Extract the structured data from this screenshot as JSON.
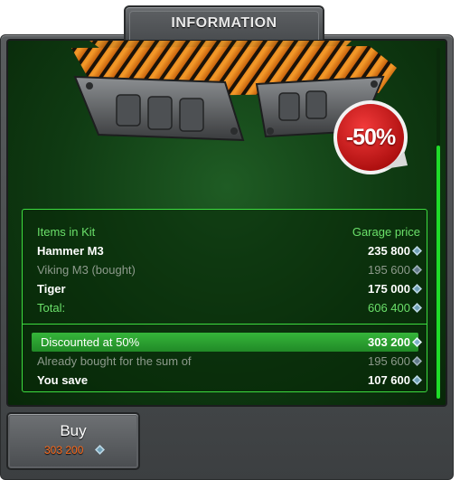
{
  "header": {
    "title": "INFORMATION"
  },
  "sticker": {
    "text": "-50%",
    "color": "#d31616"
  },
  "kit": {
    "columns": {
      "items": "Items in Kit",
      "price": "Garage price"
    },
    "items": [
      {
        "name": "Hammer M3",
        "price": "235 800",
        "state": "active"
      },
      {
        "name": "Viking M3 (bought)",
        "price": "195 600",
        "state": "owned"
      },
      {
        "name": "Tiger",
        "price": "175 000",
        "state": "active"
      }
    ],
    "total": {
      "label": "Total:",
      "price": "606 400"
    },
    "discount": {
      "label": "Discounted at 50%",
      "price": "303 200"
    },
    "already_bought": {
      "label": "Already bought for the sum of",
      "price": "195 600"
    },
    "savings": {
      "label": "You save",
      "price": "107 600"
    }
  },
  "buy": {
    "label": "Buy",
    "price": "303 200"
  },
  "icons": {
    "currency": "crystal-icon"
  },
  "colors": {
    "accent": "#3ddc3f",
    "price_highlight": "#ff6b1c"
  }
}
